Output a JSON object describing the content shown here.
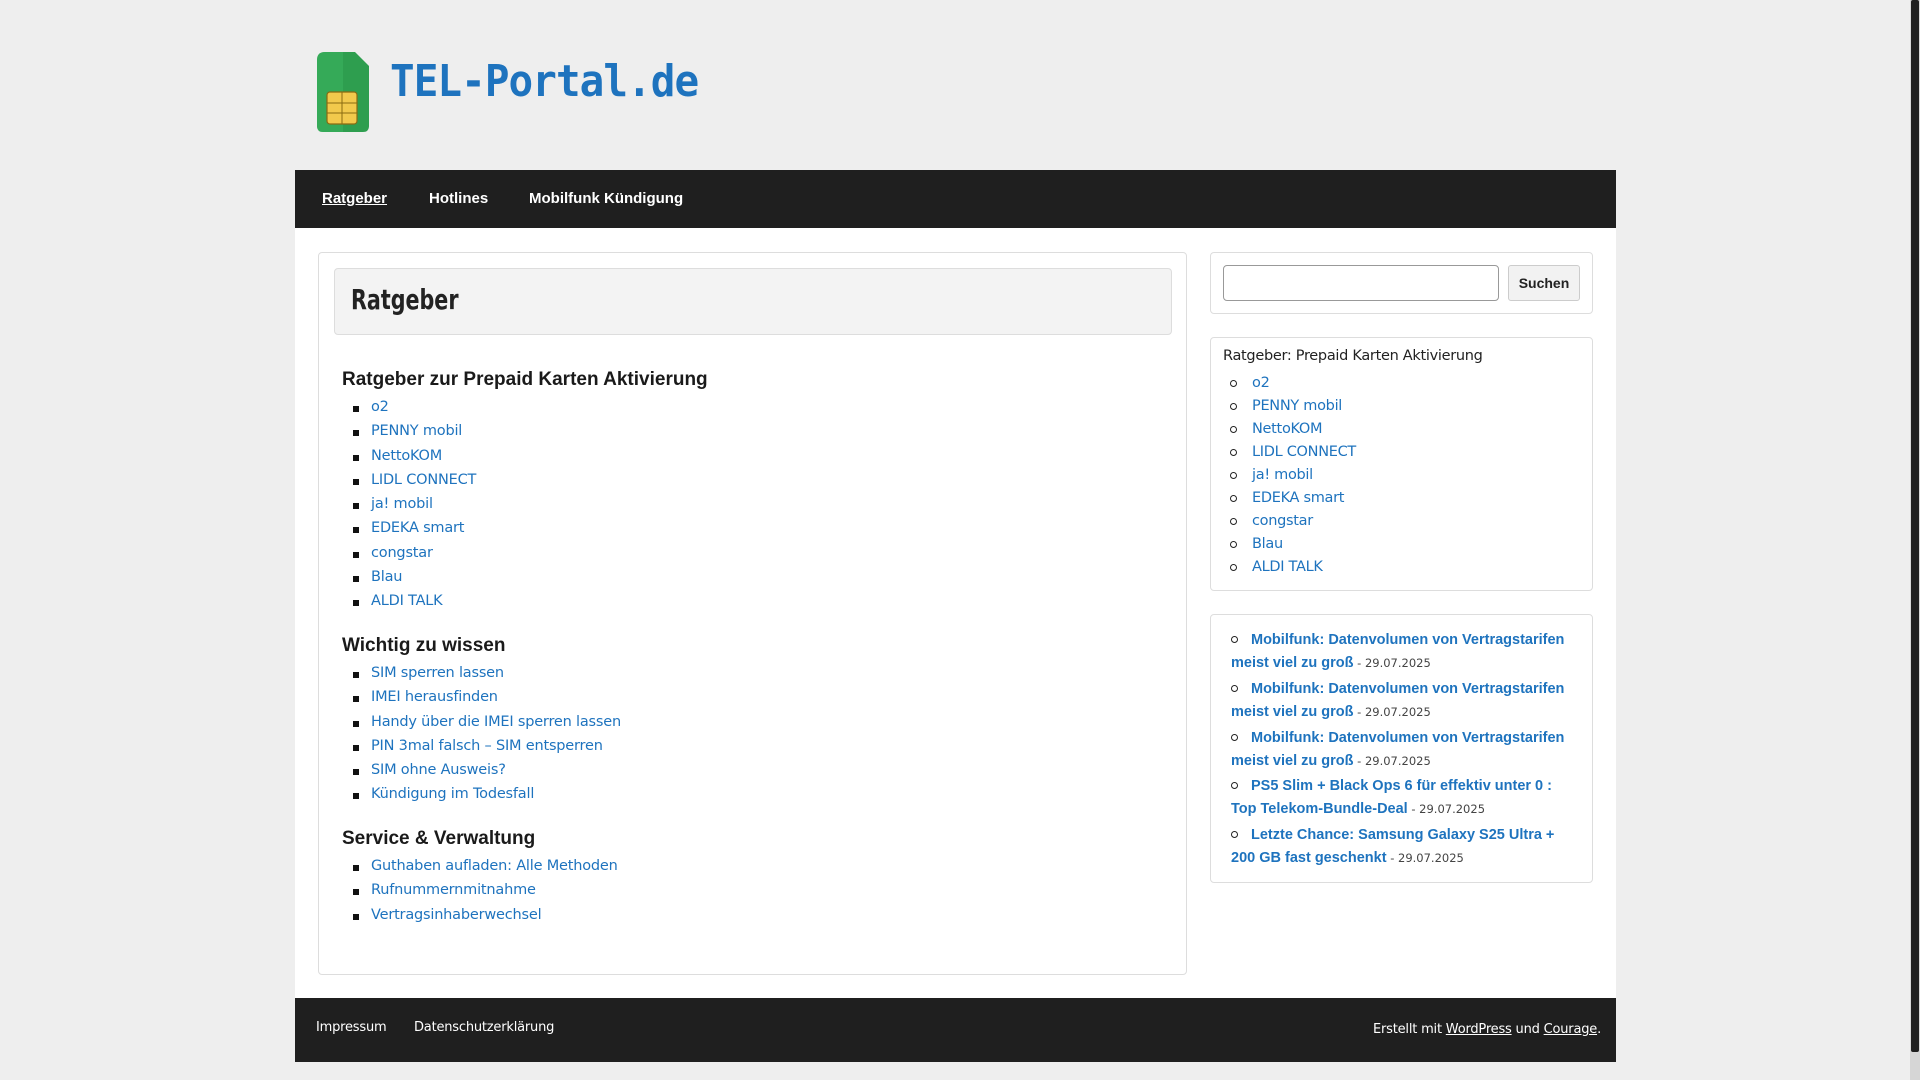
{
  "header": {
    "site_title": "TEL-Portal.de",
    "logo_icon": "sim-card-icon",
    "colors": {
      "title": "#1e73be",
      "sim_green": "#2e9e4f",
      "chip_yellow": "#f2c94c"
    }
  },
  "nav": {
    "items": [
      {
        "label": "Ratgeber",
        "active": true
      },
      {
        "label": "Hotlines",
        "active": false
      },
      {
        "label": "Mobilfunk Kündigung",
        "active": false
      }
    ]
  },
  "main": {
    "page_title": "Ratgeber",
    "sections": [
      {
        "heading": "Ratgeber zur Prepaid Karten Aktivierung",
        "links": [
          "o2",
          "PENNY mobil",
          "NettoKOM",
          "LIDL CONNECT",
          "ja! mobil",
          "EDEKA smart",
          "congstar",
          "Blau",
          "ALDI TALK"
        ]
      },
      {
        "heading": "Wichtig zu wissen",
        "links": [
          "SIM sperren lassen",
          "IMEI herausfinden",
          "Handy über die IMEI sperren lassen",
          "PIN 3mal falsch – SIM entsperren",
          "SIM ohne Ausweis?",
          "Kündigung im Todesfall"
        ]
      },
      {
        "heading": "Service & Verwaltung",
        "links": [
          "Guthaben aufladen: Alle Methoden",
          "Rufnummernmitnahme",
          "Vertragsinhaberwechsel"
        ]
      }
    ]
  },
  "sidebar": {
    "search": {
      "value": "",
      "button_label": "Suchen"
    },
    "widget": {
      "title": "Ratgeber: Prepaid Karten Aktivierung",
      "links": [
        "o2",
        "PENNY mobil",
        "NettoKOM",
        "LIDL CONNECT",
        "ja! mobil",
        "EDEKA smart",
        "congstar",
        "Blau",
        "ALDI TALK"
      ]
    },
    "news": [
      {
        "title": "Mobilfunk: Datenvolumen von Vertragstarifen meist viel zu groß",
        "date": " - 29.07.2025"
      },
      {
        "title": "Mobilfunk: Datenvolumen von Vertragstarifen meist viel zu groß",
        "date": " - 29.07.2025"
      },
      {
        "title": "Mobilfunk: Datenvolumen von Vertragstarifen meist viel zu groß",
        "date": " - 29.07.2025"
      },
      {
        "title": "PS5 Slim + Black Ops 6 für effektiv unter 0 : Top Telekom-Bundle-Deal",
        "date": " - 29.07.2025"
      },
      {
        "title": "Letzte Chance: Samsung Galaxy S25 Ultra + 200 GB fast geschenkt",
        "date": " - 29.07.2025"
      }
    ]
  },
  "footer": {
    "links": [
      "Impressum",
      "Datenschutzerklärung"
    ],
    "credit_prefix": "Erstellt mit ",
    "credit_wp": "WordPress",
    "credit_and": " und ",
    "credit_theme": "Courage",
    "credit_suffix": "."
  }
}
